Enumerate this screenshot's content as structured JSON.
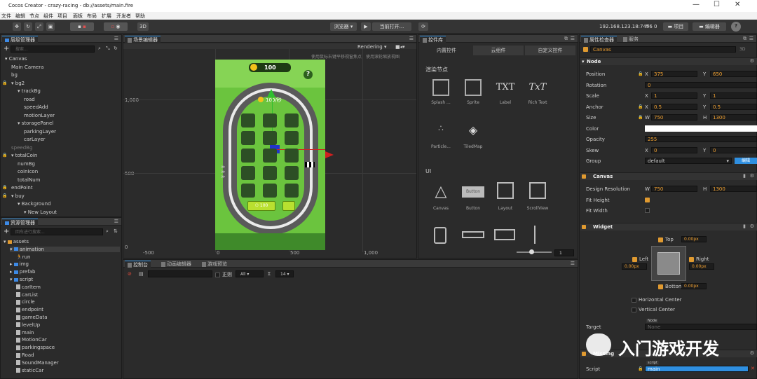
{
  "window": {
    "title": "Cocos Creator - crazy-racing - db://assets/main.fire",
    "minimize": "—",
    "maximize": "☐",
    "close": "✕"
  },
  "menu": [
    "文件",
    "编辑",
    "节点",
    "组件",
    "项目",
    "面板",
    "布局",
    "扩展",
    "开发者",
    "帮助"
  ],
  "toolbar": {
    "browser": "浏览器 ▾",
    "play_label": "当前打开...",
    "mode3d": "3D",
    "ip": "192.168.123.18:7456",
    "wifi_count": "0",
    "project": "项目",
    "editor": "编辑器",
    "help": "?"
  },
  "hierarchy": {
    "title": "层级管理器",
    "search_placeholder": "搜索...",
    "items": [
      {
        "label": "Canvas",
        "indent": 0,
        "arrow": "▾",
        "lock": false,
        "dim": false
      },
      {
        "label": "Main Camera",
        "indent": 1,
        "arrow": "",
        "lock": false,
        "dim": false
      },
      {
        "label": "bg",
        "indent": 1,
        "arrow": "",
        "lock": false,
        "dim": false
      },
      {
        "label": "bg2",
        "indent": 1,
        "arrow": "▾",
        "lock": true,
        "dim": false
      },
      {
        "label": "trackBg",
        "indent": 2,
        "arrow": "▾",
        "lock": false,
        "dim": false
      },
      {
        "label": "road",
        "indent": 3,
        "arrow": "",
        "lock": false,
        "dim": false
      },
      {
        "label": "speedAdd",
        "indent": 3,
        "arrow": "",
        "lock": false,
        "dim": false
      },
      {
        "label": "motionLayer",
        "indent": 3,
        "arrow": "",
        "lock": false,
        "dim": false
      },
      {
        "label": "storagePanel",
        "indent": 2,
        "arrow": "▾",
        "lock": false,
        "dim": false
      },
      {
        "label": "parkingLayer",
        "indent": 3,
        "arrow": "",
        "lock": false,
        "dim": false
      },
      {
        "label": "carLayer",
        "indent": 3,
        "arrow": "",
        "lock": false,
        "dim": false
      },
      {
        "label": "speedBg",
        "indent": 1,
        "arrow": "",
        "lock": false,
        "dim": true
      },
      {
        "label": "totalCoin",
        "indent": 1,
        "arrow": "▾",
        "lock": true,
        "dim": false
      },
      {
        "label": "numBg",
        "indent": 2,
        "arrow": "",
        "lock": false,
        "dim": false
      },
      {
        "label": "coinIcon",
        "indent": 2,
        "arrow": "",
        "lock": false,
        "dim": false
      },
      {
        "label": "totalNum",
        "indent": 2,
        "arrow": "",
        "lock": false,
        "dim": false
      },
      {
        "label": "endPoint",
        "indent": 1,
        "arrow": "",
        "lock": true,
        "dim": false
      },
      {
        "label": "buy",
        "indent": 1,
        "arrow": "▾",
        "lock": true,
        "dim": false
      },
      {
        "label": "Background",
        "indent": 2,
        "arrow": "▾",
        "lock": false,
        "dim": false
      },
      {
        "label": "New Layout",
        "indent": 3,
        "arrow": "▾",
        "lock": false,
        "dim": false
      }
    ]
  },
  "assets": {
    "title": "资源管理器",
    "search_placeholder": "回车进行搜索...",
    "items": [
      {
        "label": "assets",
        "indent": 0,
        "type": "root",
        "arrow": "▾"
      },
      {
        "label": "animation",
        "indent": 1,
        "type": "folder",
        "arrow": "▾"
      },
      {
        "label": "run",
        "indent": 2,
        "type": "anim",
        "arrow": ""
      },
      {
        "label": "img",
        "indent": 1,
        "type": "folder",
        "arrow": "▸"
      },
      {
        "label": "prefab",
        "indent": 1,
        "type": "folder",
        "arrow": "▸"
      },
      {
        "label": "script",
        "indent": 1,
        "type": "folder",
        "arrow": "▾"
      },
      {
        "label": "carItem",
        "indent": 2,
        "type": "file",
        "arrow": ""
      },
      {
        "label": "carList",
        "indent": 2,
        "type": "file",
        "arrow": ""
      },
      {
        "label": "circle",
        "indent": 2,
        "type": "file",
        "arrow": ""
      },
      {
        "label": "endpoint",
        "indent": 2,
        "type": "file",
        "arrow": ""
      },
      {
        "label": "gameData",
        "indent": 2,
        "type": "file",
        "arrow": ""
      },
      {
        "label": "levelUp",
        "indent": 2,
        "type": "file",
        "arrow": ""
      },
      {
        "label": "main",
        "indent": 2,
        "type": "file",
        "arrow": ""
      },
      {
        "label": "MotionCar",
        "indent": 2,
        "type": "file",
        "arrow": ""
      },
      {
        "label": "parkingspace",
        "indent": 2,
        "type": "file",
        "arrow": ""
      },
      {
        "label": "Road",
        "indent": 2,
        "type": "file",
        "arrow": ""
      },
      {
        "label": "SoundManager",
        "indent": 2,
        "type": "file",
        "arrow": ""
      },
      {
        "label": "staticCar",
        "indent": 2,
        "type": "file",
        "arrow": ""
      }
    ]
  },
  "scene": {
    "title": "场景编辑器",
    "hint": "使用鼠标右键平移视窗焦点，使用滚轮缩放视图",
    "rendering": "Rendering ▾",
    "ylabels": [
      "1,000",
      "500",
      "0"
    ],
    "xlabels": [
      "-500",
      "0",
      "500",
      "1,000"
    ],
    "coin_value": "100",
    "speed_text": "100/秒",
    "question": "?",
    "buy_label": "100",
    "zoom_value": "1"
  },
  "bottom_tabs": [
    "控制台",
    "动画编辑器",
    "游戏预览"
  ],
  "console": {
    "regex": "正则",
    "level": "All",
    "fontsize": "14"
  },
  "library": {
    "title": "控件库",
    "tabs": [
      "内置控件",
      "云组件",
      "自定义控件"
    ],
    "section1": "渲染节点",
    "items1": [
      "Splash ...",
      "Sprite",
      "Label",
      "Rich Text",
      "Particle...",
      "TiledMap"
    ],
    "glyph_label": "TXT",
    "glyph_rich": "TxT",
    "section2": "UI",
    "items2": [
      "Canvas",
      "Button",
      "Layout",
      "ScrollView"
    ],
    "button_preview": "Button"
  },
  "inspector": {
    "tabs": [
      "属性检查器",
      "服务"
    ],
    "node_name": "Canvas",
    "node_3d": "3D",
    "node_section": "Node",
    "position": {
      "label": "Position",
      "x": "375",
      "y": "650"
    },
    "rotation": {
      "label": "Rotation",
      "v": "0"
    },
    "scale": {
      "label": "Scale",
      "x": "1",
      "y": "1"
    },
    "anchor": {
      "label": "Anchor",
      "x": "0.5",
      "y": "0.5"
    },
    "size": {
      "label": "Size",
      "w": "750",
      "h": "1300"
    },
    "color": {
      "label": "Color"
    },
    "opacity": {
      "label": "Opacity",
      "v": "255"
    },
    "skew": {
      "label": "Skew",
      "x": "0",
      "y": "0"
    },
    "group": {
      "label": "Group",
      "v": "default",
      "edit": "编辑"
    },
    "canvas_section": "Canvas",
    "design": {
      "label": "Design Resolution",
      "w": "750",
      "h": "1300"
    },
    "fit_height": "Fit Height",
    "fit_width": "Fit Width",
    "widget_section": "Widget",
    "top": "Top",
    "top_v": "0.00px",
    "left": "Left",
    "left_v": "0.00px",
    "right": "Right",
    "right_v": "0.00px",
    "bottom": "Bottom",
    "bottom_v": "0.00px",
    "hcenter": "Horizontal Center",
    "vcenter": "Vertical Center",
    "target": "Target",
    "target_badge": "Node",
    "target_v": "None",
    "missing_section": "Missing",
    "script_label": "Script",
    "script_badge": "script",
    "script_v": "main",
    "axis": {
      "x": "X",
      "y": "Y",
      "w": "W",
      "h": "H"
    }
  },
  "watermark": "入门游戏开发",
  "colors": {
    "accent": "#2f8fe0",
    "orange": "#e09a30",
    "green": "#5fbf3a"
  }
}
